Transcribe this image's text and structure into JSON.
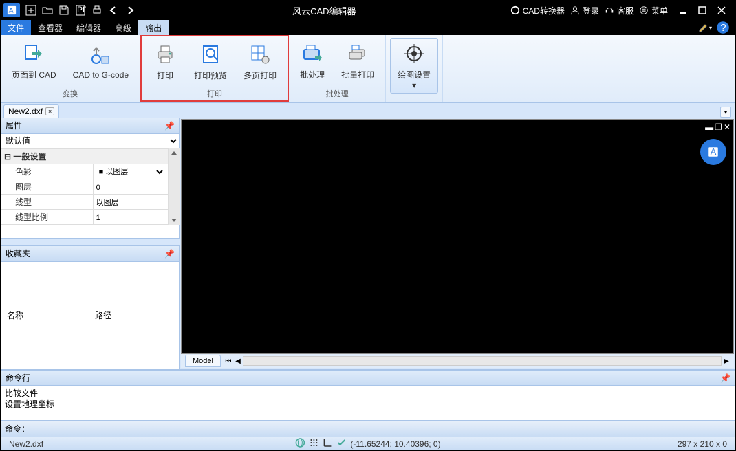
{
  "title": "风云CAD编辑器",
  "titlebar_links": {
    "converter": "CAD转换器",
    "login": "登录",
    "support": "客服",
    "menu": "菜单"
  },
  "menu": {
    "file": "文件",
    "viewer": "查看器",
    "editor": "编辑器",
    "advanced": "高级",
    "output": "输出"
  },
  "ribbon": {
    "groups": {
      "convert": {
        "label": "变换",
        "page_to_cad": "页面到 CAD",
        "cad_to_gcode": "CAD to G-code"
      },
      "print": {
        "label": "打印",
        "print": "打印",
        "preview": "打印预览",
        "multipage": "多页打印"
      },
      "batch": {
        "label": "批处理",
        "batch": "批处理",
        "batch_print": "批量打印"
      },
      "draw": {
        "label": "",
        "settings": "绘图设置"
      }
    }
  },
  "filetab": {
    "name": "New2.dxf"
  },
  "props": {
    "title": "属性",
    "default": "默认值",
    "section_general": "一般设置",
    "rows": {
      "color_label": "色彩",
      "color_value": "以图层",
      "layer_label": "图层",
      "layer_value": "0",
      "linetype_label": "线型",
      "linetype_value": "以图层",
      "ltscale_label": "线型比例",
      "ltscale_value": "1"
    }
  },
  "favorites": {
    "title": "收藏夹",
    "col_name": "名称",
    "col_path": "路径"
  },
  "canvas": {
    "tab_model": "Model"
  },
  "cmdline": {
    "title": "命令行",
    "history1": "比较文件",
    "history2": "设置地理坐标",
    "prompt": "命令："
  },
  "status": {
    "file": "New2.dxf",
    "coords": "(-11.65244; 10.40396; 0)",
    "dims": "297 x 210 x 0"
  }
}
